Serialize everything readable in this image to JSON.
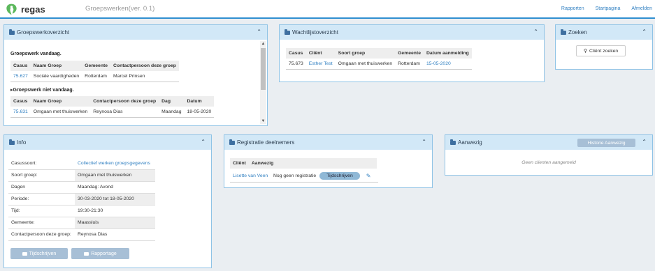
{
  "header": {
    "logo_text": "regas",
    "app_title": "Groepswerken(ver. 0.1)",
    "nav": [
      "Rapporten",
      "Startpagina",
      "Afmelden"
    ]
  },
  "groepswerk": {
    "title": "Groepswerkoverzicht",
    "today_title": "Groepswerk vandaag.",
    "today_columns": [
      "Casus",
      "Naam Groep",
      "Gemeente",
      "Contactpersoon deze groep"
    ],
    "today_rows": [
      [
        "75.627",
        "Sociale vaardigheden",
        "Rotterdam",
        "Marcel Prinsen"
      ]
    ],
    "other_title": "Groepswerk niet vandaag.",
    "other_columns": [
      "Casus",
      "Naam Groep",
      "Contactpersoon deze groep",
      "Dag",
      "Datum"
    ],
    "other_rows": [
      [
        "75.631",
        "Omgaan met thuiswerken",
        "Reynosa Dias",
        "Maandag",
        "18-05-2020"
      ]
    ]
  },
  "wachtlijst": {
    "title": "Wachtlijstoverzicht",
    "columns": [
      "Casus",
      "Cliënt",
      "Soort groep",
      "Gemeente",
      "Datum aanmelding"
    ],
    "rows": [
      [
        "75.673",
        "Esther Test",
        "Omgaan met thuiswerken",
        "Rotterdam",
        "15-05-2020"
      ]
    ]
  },
  "zoeken": {
    "title": "Zoeken",
    "button": "Cliënt zoeken"
  },
  "info": {
    "title": "Info",
    "rows": [
      {
        "label": "Casussoort:",
        "value": "Collectief werken groepsgegevens"
      },
      {
        "label": "Soort groep:",
        "value": "Omgaan met thuiswerken"
      },
      {
        "label": "Dagen",
        "value": "Maandag: Avond"
      },
      {
        "label": "Periode:",
        "value": "30-03-2020 tot 18-05-2020"
      },
      {
        "label": "Tijd:",
        "value": "19:30-21:30"
      },
      {
        "label": "Gemeente:",
        "value": "Maassluis"
      },
      {
        "label": "Contactpersoon deze groep:",
        "value": "Reynosa  Dias"
      }
    ],
    "btn_tijdschrijven": "Tijdschrijven",
    "btn_rapportage": "Rapportage"
  },
  "registratie": {
    "title": "Registratie deelnemers",
    "columns": [
      "Cliënt",
      "Aanwezig"
    ],
    "client": "Lisette van Veen",
    "status": "Nog geen registratie",
    "button": "Tijdschrijven"
  },
  "aanwezig": {
    "title": "Aanwezig",
    "history_button": "Historie Aanwezig",
    "empty": "Geen clienten aangemeld"
  }
}
